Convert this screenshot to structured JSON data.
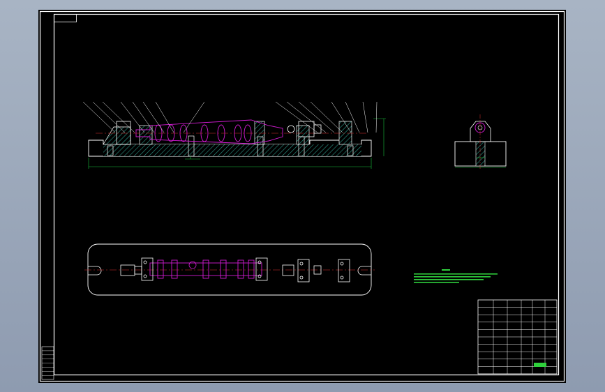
{
  "drawing": {
    "background": "#000000",
    "colors": {
      "frame": "#ffffff",
      "part": "#ffffff",
      "hatch": "#2f9e8e",
      "workpiece": "#d21bd2",
      "dimension": "#18c23c",
      "leader": "#ffffff",
      "centerline": "#e03030",
      "note": "#2fd13c",
      "title_fill": "#2fd13c"
    },
    "front_view": {
      "balloon_count": 18,
      "has_section_hatch": true
    },
    "side_view": {
      "has_section_hatch": true
    },
    "top_view": {
      "slot_ends": 2,
      "clamps": 4
    },
    "notes": {
      "line_count": 4
    },
    "title_block": {
      "rows": 10,
      "columns": 6
    },
    "revision_block": {
      "rows": 8
    }
  }
}
